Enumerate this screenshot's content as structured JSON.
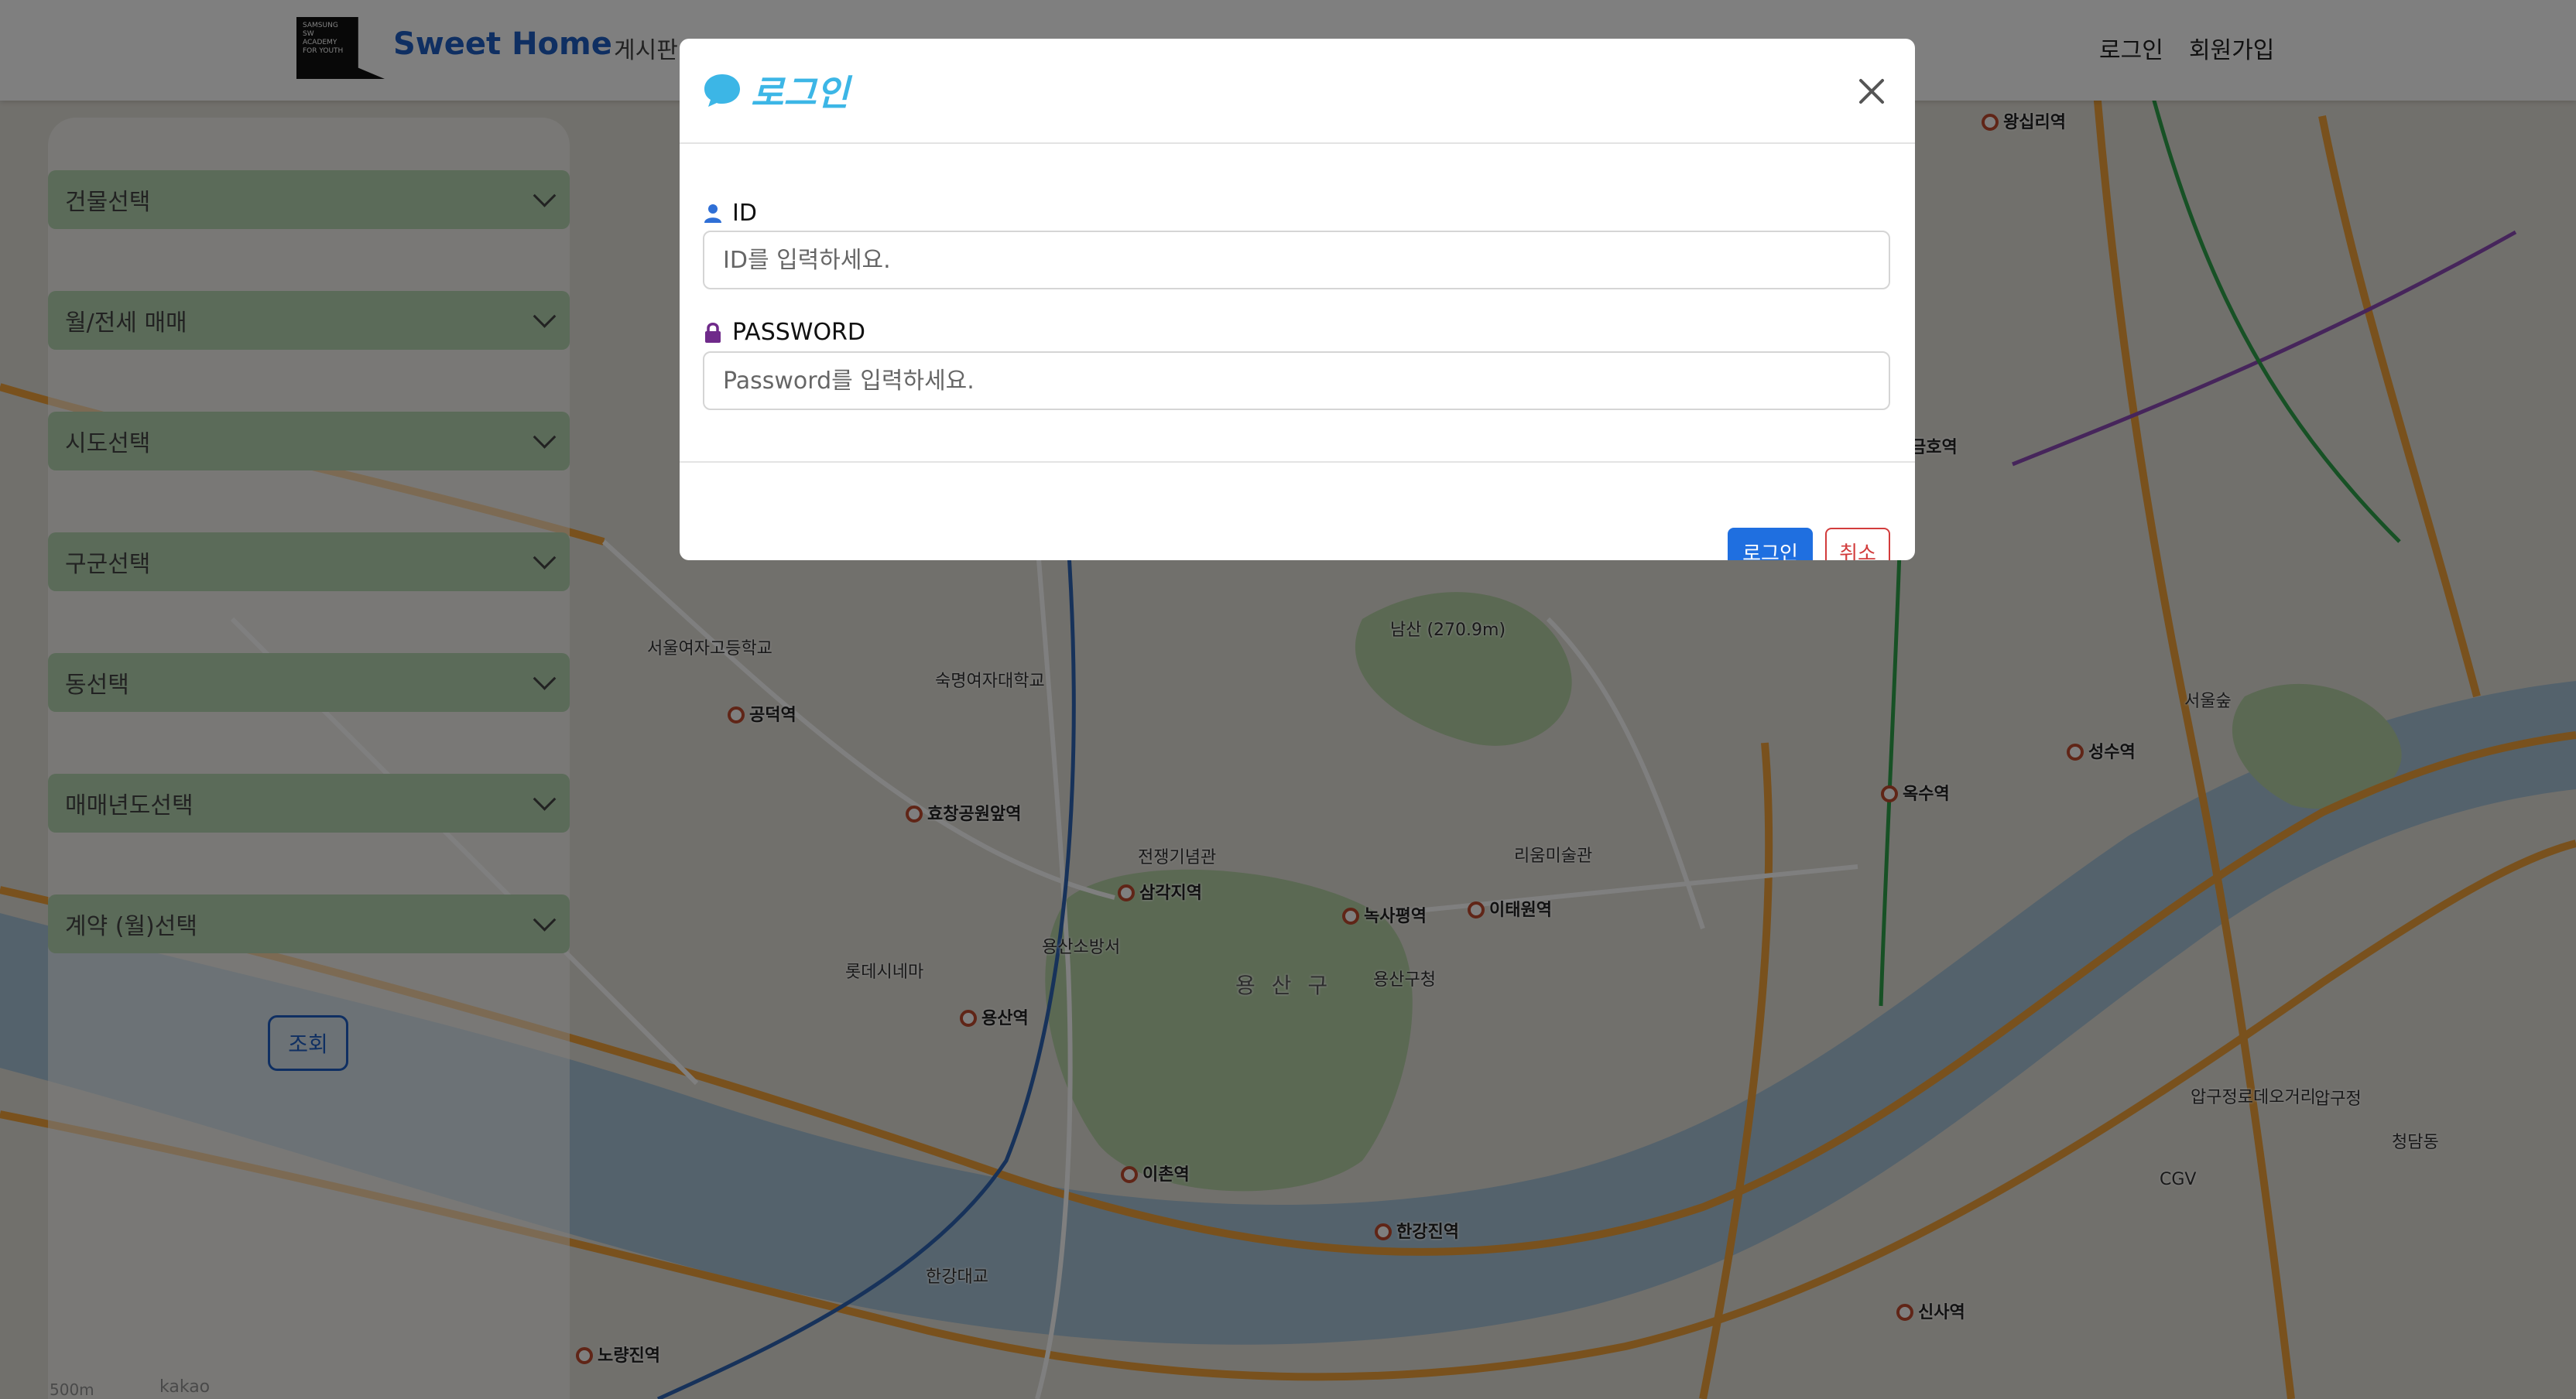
{
  "navbar": {
    "brand_logo_text": "SAMSUNG SW ACADEMY FOR YOUTH",
    "brand_name": "Sweet Home",
    "board": "게시판",
    "login": "로그인",
    "signup": "회원가입"
  },
  "sidebar": {
    "selects": [
      "건물선택",
      "월/전세 매매",
      "시도선택",
      "구군선택",
      "동선택",
      "매매년도선택",
      "계약 (월)선택"
    ],
    "search_button": "조회"
  },
  "map": {
    "labels": [
      "용 산 구",
      "남산\n(270.9m)",
      "이촌역",
      "용산역",
      "삼각지역",
      "녹사평역",
      "이태원역",
      "한강진역",
      "옥수역",
      "금호역",
      "신사역",
      "압구정로데오거리",
      "성수역",
      "왕십리역",
      "노량진역",
      "효창공원앞역",
      "공덕역",
      "숙명여자대학교",
      "용산구청",
      "리움미술관",
      "전쟁기념관",
      "롯데시네마",
      "CGV",
      "압구정",
      "청담동",
      "서울숲",
      "한강대교",
      "서울여자고등학교",
      "용산소방서"
    ],
    "scale": "500m",
    "provider": "kakao"
  },
  "modal": {
    "title": "로그인",
    "id_label": "ID",
    "id_placeholder": "ID를 입력하세요.",
    "password_label": "PASSWORD",
    "password_placeholder": "Password를 입력하세요.",
    "submit": "로그인",
    "cancel": "취소"
  },
  "colors": {
    "brand": "#1f5fc4",
    "title_accent": "#3cb6e6",
    "submit_bg": "#1f6fe0",
    "cancel": "#d23c3c",
    "select_bg": "#b7d7b3"
  }
}
